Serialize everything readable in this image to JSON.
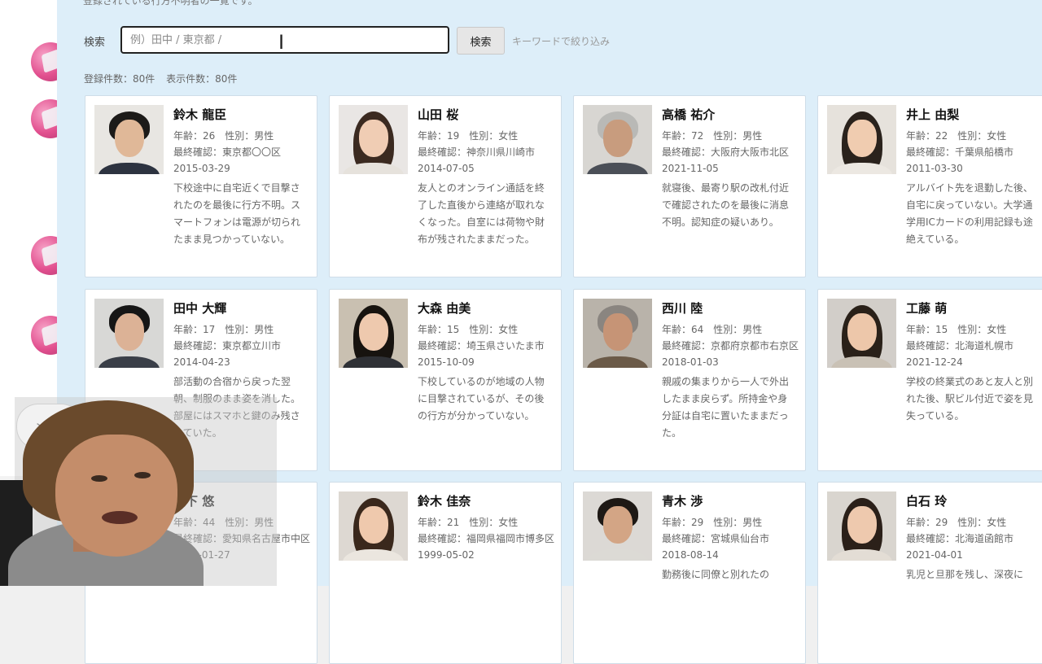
{
  "page": {
    "note": "登録されている行方不明者の一覧です。",
    "search": {
      "label": "検索",
      "placeholder": "例）田中 / 東京都 /",
      "button": "検索",
      "hint": "キーワードで絞り込み"
    },
    "counts": {
      "registered": "登録件数：80件",
      "shown": "表示件数：80件"
    }
  },
  "colors": {
    "panel_bg": "#ddeef9",
    "card_border": "#cfdde8",
    "text_muted": "#666666"
  },
  "cards": [
    {
      "name": "鈴木 龍臣",
      "meta": "年齢：26　性別：男性",
      "seen": "最終確認：東京都〇〇区",
      "date": "2015-03-29",
      "desc": "下校途中に自宅近くで目撃されたのを最後に行方不明。スマートフォンは電源が切られたまま見つかっていない。"
    },
    {
      "name": "山田 桜",
      "meta": "年齢：19　性別：女性",
      "seen": "最終確認：神奈川県川崎市",
      "date": "2014-07-05",
      "desc": "友人とのオンライン通話を終了した直後から連絡が取れなくなった。自室には荷物や財布が残されたままだった。"
    },
    {
      "name": "高橋 祐介",
      "meta": "年齢：72　性別：男性",
      "seen": "最終確認：大阪府大阪市北区",
      "date": "2021-11-05",
      "desc": "就寝後、最寄り駅の改札付近で確認されたのを最後に消息不明。認知症の疑いあり。"
    },
    {
      "name": "井上 由梨",
      "meta": "年齢：22　性別：女性",
      "seen": "最終確認：千葉県船橋市",
      "date": "2011-03-30",
      "desc": "アルバイト先を退勤した後、自宅に戻っていない。大学通学用ICカードの利用記録も途絶えている。"
    },
    {
      "name": "田中 大輝",
      "meta": "年齢：17　性別：男性",
      "seen": "最終確認：東京都立川市",
      "date": "2014-04-23",
      "desc": "部活動の合宿から戻った翌朝、制服のまま姿を消した。部屋にはスマホと鍵のみ残されていた。"
    },
    {
      "name": "大森 由美",
      "meta": "年齢：15　性別：女性",
      "seen": "最終確認：埼玉県さいたま市",
      "date": "2015-10-09",
      "desc": "下校しているのが地域の人物に目撃されているが、その後の行方が分かっていない。"
    },
    {
      "name": "西川 陸",
      "meta": "年齢：64　性別：男性",
      "seen": "最終確認：京都府京都市右京区",
      "date": "2018-01-03",
      "desc": "親戚の集まりから一人で外出したまま戻らず。所持金や身分証は自宅に置いたままだった。"
    },
    {
      "name": "工藤 萌",
      "meta": "年齢：15　性別：女性",
      "seen": "最終確認：北海道札幌市",
      "date": "2021-12-24",
      "desc": "学校の終業式のあと友人と別れた後、駅ビル付近で姿を見失っている。"
    },
    {
      "name": "森下 悠",
      "meta": "年齢：44　性別：男性",
      "seen": "最終確認：愛知県名古屋市中区",
      "date": "2010-01-27",
      "desc": ""
    },
    {
      "name": "鈴木 佳奈",
      "meta": "年齢：21　性別：女性",
      "seen": "最終確認：福岡県福岡市博多区",
      "date": "1999-05-02",
      "desc": ""
    },
    {
      "name": "青木 渉",
      "meta": "年齢：29　性別：男性",
      "seen": "最終確認：宮城県仙台市",
      "date": "2018-08-14",
      "desc": "勤務後に同僚と別れたの"
    },
    {
      "name": "白石 玲",
      "meta": "年齢：29　性別：女性",
      "seen": "最終確認：北海道函館市",
      "date": "2021-04-01",
      "desc": "乳児と旦那を残し、深夜に"
    }
  ],
  "overlay": {
    "chat_placeholder": "メ"
  }
}
